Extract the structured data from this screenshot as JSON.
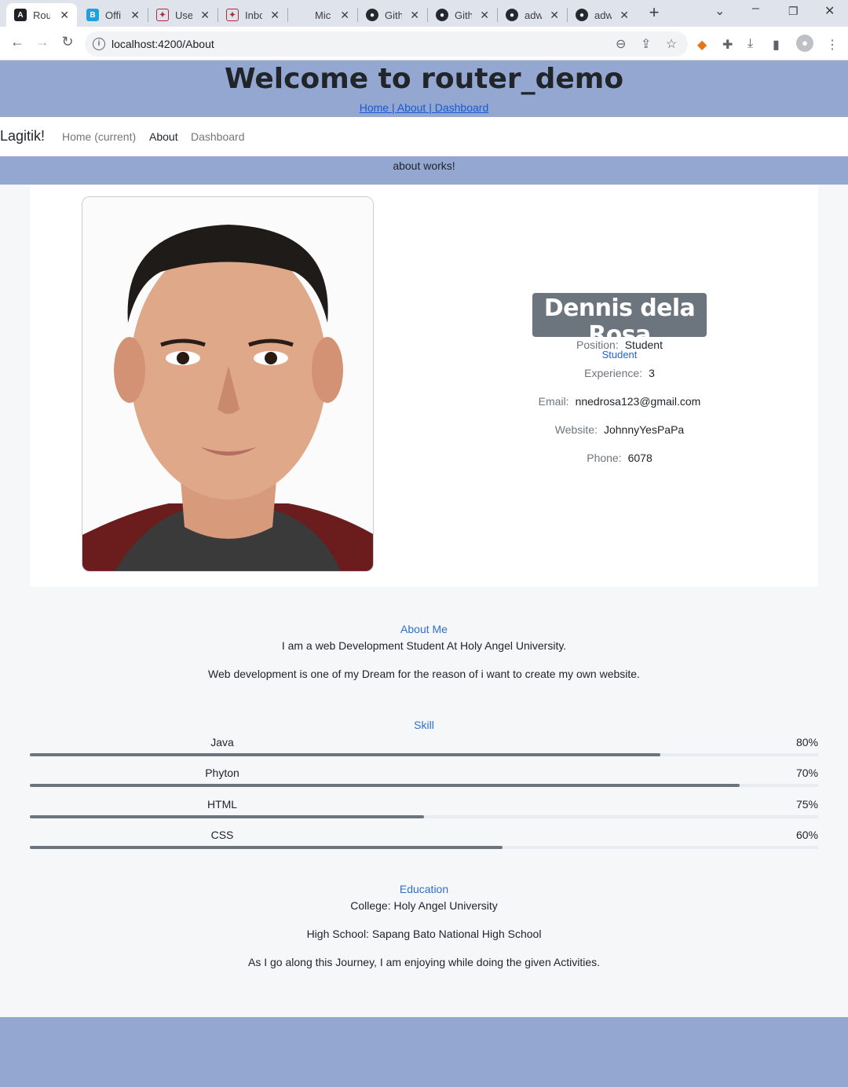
{
  "browser": {
    "tabs": [
      {
        "title": "Rou",
        "icon": "angular-icon",
        "active": true
      },
      {
        "title": "Offi",
        "icon": "bootstrap-icon"
      },
      {
        "title": "Use",
        "icon": "school-icon"
      },
      {
        "title": "Inbc",
        "icon": "school-icon"
      },
      {
        "title": "Mic",
        "icon": "microsoft-icon"
      },
      {
        "title": "Gith",
        "icon": "github-icon"
      },
      {
        "title": "Gith",
        "icon": "github-icon"
      },
      {
        "title": "adw",
        "icon": "github-icon"
      },
      {
        "title": "adw",
        "icon": "github-icon"
      }
    ],
    "url": "localhost:4200/About"
  },
  "header": {
    "title": "Welcome to router_demo",
    "links": "Home | About | Dashboard"
  },
  "navbar": {
    "brand": "Lagitik!",
    "items": [
      "Home (current)",
      "About",
      "Dashboard"
    ]
  },
  "banner": "about works!",
  "profile": {
    "name": "Dennis dela Rosa",
    "role": "Student",
    "fields": [
      {
        "label": "Position:",
        "value": "Student"
      },
      {
        "label": "Experience:",
        "value": "3"
      },
      {
        "label": "Email:",
        "value": "nnedrosa123@gmail.com"
      },
      {
        "label": "Website:",
        "value": "JohnnyYesPaPa"
      },
      {
        "label": "Phone:",
        "value": "6078"
      }
    ]
  },
  "about": {
    "title": "About Me",
    "lines": [
      "I am a web Development Student At Holy Angel University.",
      "Web development is one of my Dream for the reason of i want to create my own website."
    ]
  },
  "skills": {
    "title": "Skill",
    "items": [
      {
        "name": "Java",
        "percent": "80%",
        "fill": 0.8
      },
      {
        "name": "Phyton",
        "percent": "70%",
        "fill": 0.9
      },
      {
        "name": "HTML",
        "percent": "75%",
        "fill": 0.5
      },
      {
        "name": "CSS",
        "percent": "60%",
        "fill": 0.6
      }
    ]
  },
  "education": {
    "title": "Education",
    "lines": [
      "College: Holy Angel University",
      "High School: Sapang Bato National High School",
      "As I go along this Journey, I am enjoying while doing the given Activities."
    ]
  }
}
